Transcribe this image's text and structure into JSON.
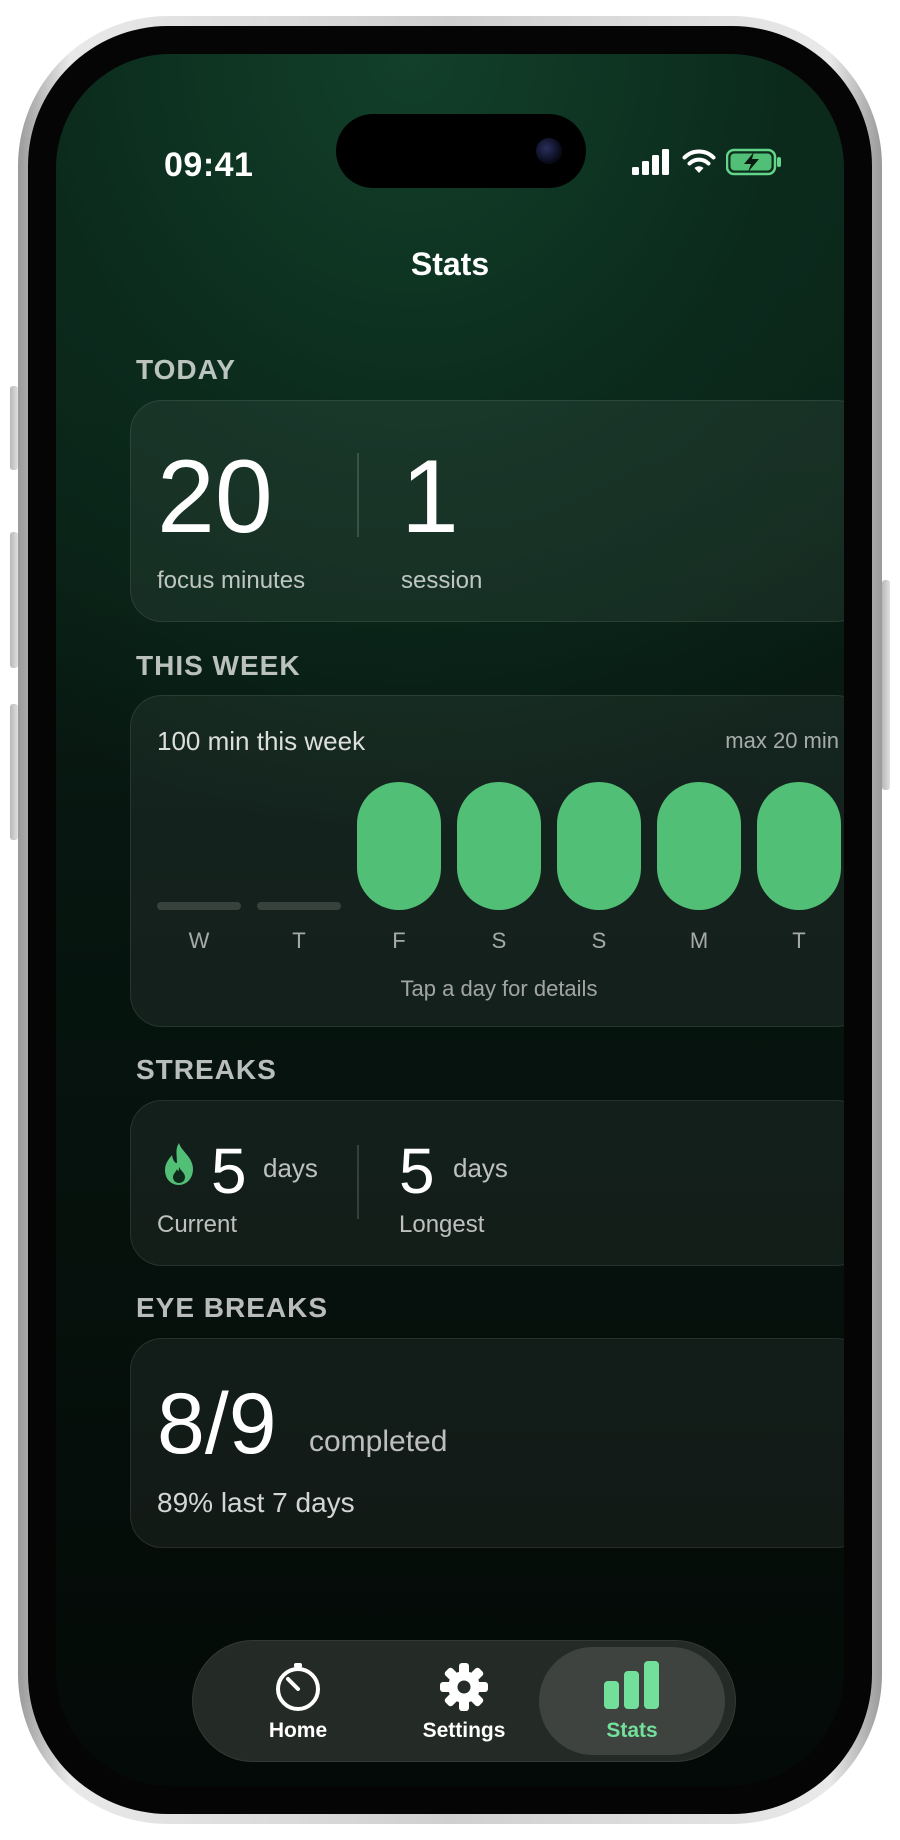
{
  "status_bar": {
    "time": "09:41"
  },
  "header": {
    "title": "Stats"
  },
  "today": {
    "section_label": "TODAY",
    "focus_value": "20",
    "focus_label": "focus minutes",
    "session_value": "1",
    "session_label": "session"
  },
  "week": {
    "section_label": "THIS WEEK",
    "total_text": "100 min this week",
    "max_text": "max 20 min",
    "hint": "Tap a day for details",
    "days": [
      {
        "label": "W",
        "minutes": 0
      },
      {
        "label": "T",
        "minutes": 0
      },
      {
        "label": "F",
        "minutes": 20
      },
      {
        "label": "S",
        "minutes": 20
      },
      {
        "label": "S",
        "minutes": 20
      },
      {
        "label": "M",
        "minutes": 20
      },
      {
        "label": "T",
        "minutes": 20
      }
    ],
    "max_minutes": 20
  },
  "streaks": {
    "section_label": "STREAKS",
    "current_value": "5",
    "current_unit": "days",
    "current_label": "Current",
    "longest_value": "5",
    "longest_unit": "days",
    "longest_label": "Longest"
  },
  "eye_breaks": {
    "section_label": "EYE BREAKS",
    "value": "8/9",
    "value_suffix": "completed",
    "summary": "89% last 7 days"
  },
  "tab_bar": {
    "tabs": [
      {
        "label": "Home",
        "icon": "timer-icon",
        "active": false
      },
      {
        "label": "Settings",
        "icon": "gear-icon",
        "active": false
      },
      {
        "label": "Stats",
        "icon": "bar-chart-icon",
        "active": true
      }
    ]
  },
  "colors": {
    "accent": "#52bf76",
    "accent_active": "#72e09a"
  }
}
